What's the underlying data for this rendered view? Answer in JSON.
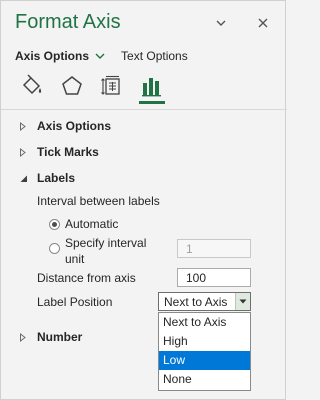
{
  "panel": {
    "title": "Format Axis",
    "icons": {
      "dropdown": "chevron-down-icon",
      "close": "close-icon"
    }
  },
  "tabs": {
    "axis_options": "Axis Options",
    "text_options": "Text Options"
  },
  "category_icons": [
    "fill-line-icon",
    "effects-pentagon-icon",
    "size-properties-icon",
    "axis-options-bar-chart-icon"
  ],
  "sections": {
    "axis_options": "Axis Options",
    "tick_marks": "Tick Marks",
    "labels": "Labels",
    "number": "Number"
  },
  "labels_section": {
    "interval_label": "Interval between labels",
    "automatic": "Automatic",
    "specify_line1": "Specify interval",
    "specify_line2": "unit",
    "specify_value": "1",
    "distance_label": "Distance from axis",
    "distance_value": "100",
    "position_label": "Label Position",
    "position_value": "Next to Axis"
  },
  "dropdown_options": [
    "Next to Axis",
    "High",
    "Low",
    "None"
  ],
  "colors": {
    "accent": "#217346",
    "highlight": "#0078d7"
  }
}
